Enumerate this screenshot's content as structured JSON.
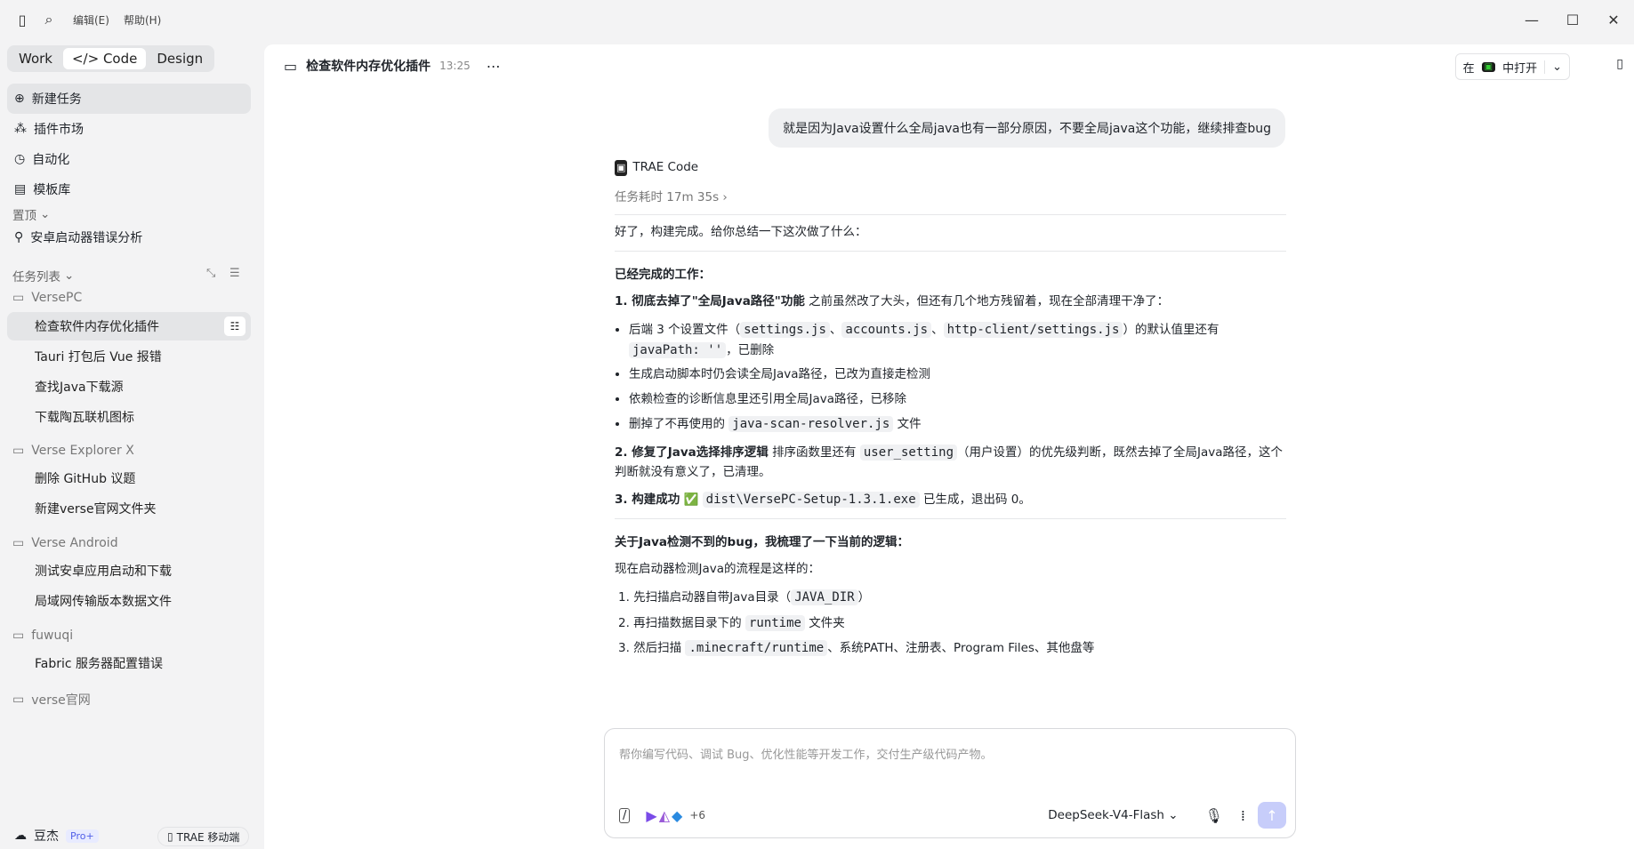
{
  "menu": {
    "edit": "编辑(E)",
    "help": "帮助(H)"
  },
  "modes": [
    "Work",
    "Code",
    "Design"
  ],
  "nav": {
    "new_task": "新建任务",
    "plugins": "插件市场",
    "automation": "自动化",
    "templates": "模板库"
  },
  "pinned": {
    "label": "置顶",
    "item": "安卓启动器错误分析"
  },
  "tasks": {
    "label": "任务列表",
    "groups": [
      {
        "name": "VersePC",
        "items": [
          "检查软件内存优化插件",
          "Tauri 打包后 Vue 报错",
          "查找Java下载源",
          "下载陶瓦联机图标"
        ]
      },
      {
        "name": "Verse Explorer X",
        "items": [
          "删除 GitHub 议题",
          "新建verse官网文件夹"
        ]
      },
      {
        "name": "Verse Android",
        "items": [
          "测试安卓应用启动和下载",
          "局域网传输版本数据文件"
        ]
      },
      {
        "name": "fuwuqi",
        "items": [
          "Fabric 服务器配置错误"
        ]
      },
      {
        "name": "verse官网",
        "items": []
      }
    ]
  },
  "user": {
    "name": "豆杰",
    "badge": "Pro+",
    "mobile": "TRAE 移动端"
  },
  "chat": {
    "title": "检查软件内存优化插件",
    "time": "13:25",
    "open_in": "在",
    "open_in2": "中打开",
    "user_msg": "就是因为Java设置什么全局java也有一部分原因，不要全局java这个功能，继续排查bug",
    "agent": "TRAE Code",
    "duration": "任务耗时 17m 35s",
    "intro": "好了，构建完成。给你总结一下这次做了什么：",
    "done_title": "已经完成的工作：",
    "p1_bold": "1. 彻底去掉了\"全局Java路径\"功能",
    "p1_rest": "之前虽然改了大头，但还有几个地方残留着，现在全部清理干净了：",
    "b1a": "后端 3 个设置文件（",
    "f1": "settings.js",
    "sep": "、",
    "f2": "accounts.js",
    "f3": "http-client/settings.js",
    "b1b": "）的默认值里还有",
    "f4": "javaPath: ''",
    "b1c": "，已删除",
    "b2": "生成启动脚本时仍会读全局Java路径，已改为直接走检测",
    "b3": "依赖检查的诊断信息里还引用全局Java路径，已移除",
    "b4a": "删掉了不再使用的",
    "f5": "java-scan-resolver.js",
    "b4b": "文件",
    "p2_bold": "2. 修复了Java选择排序逻辑",
    "p2a": "排序函数里还有",
    "f6": "user_setting",
    "p2b": "（用户设置）的优先级判断，既然去掉了全局Java路径，这个判断就没有意义了，已清理。",
    "p3_bold": "3. 构建成功",
    "check": "✅",
    "f7": "dist\\VersePC-Setup-1.3.1.exe",
    "p3b": "已生成，退出码 0。",
    "bug_title": "关于Java检测不到的bug，我梳理了一下当前的逻辑：",
    "flow": "现在启动器检测Java的流程是这样的：",
    "o1a": "1. 先扫描启动器自带Java目录（",
    "f8": "JAVA_DIR",
    "o1b": "）",
    "o2a": "2. 再扫描数据目录下的",
    "f9": "runtime",
    "o2b": "文件夹",
    "o3a": "3. 然后扫描",
    "f10": ".minecraft/runtime",
    "o3b": "、系统PATH、注册表、Program Files、其他盘等",
    "placeholder": "帮你编写代码、调试 Bug、优化性能等开发工作，交付生产级代码产物。",
    "model": "DeepSeek-V4-Flash",
    "plus": "+6"
  }
}
